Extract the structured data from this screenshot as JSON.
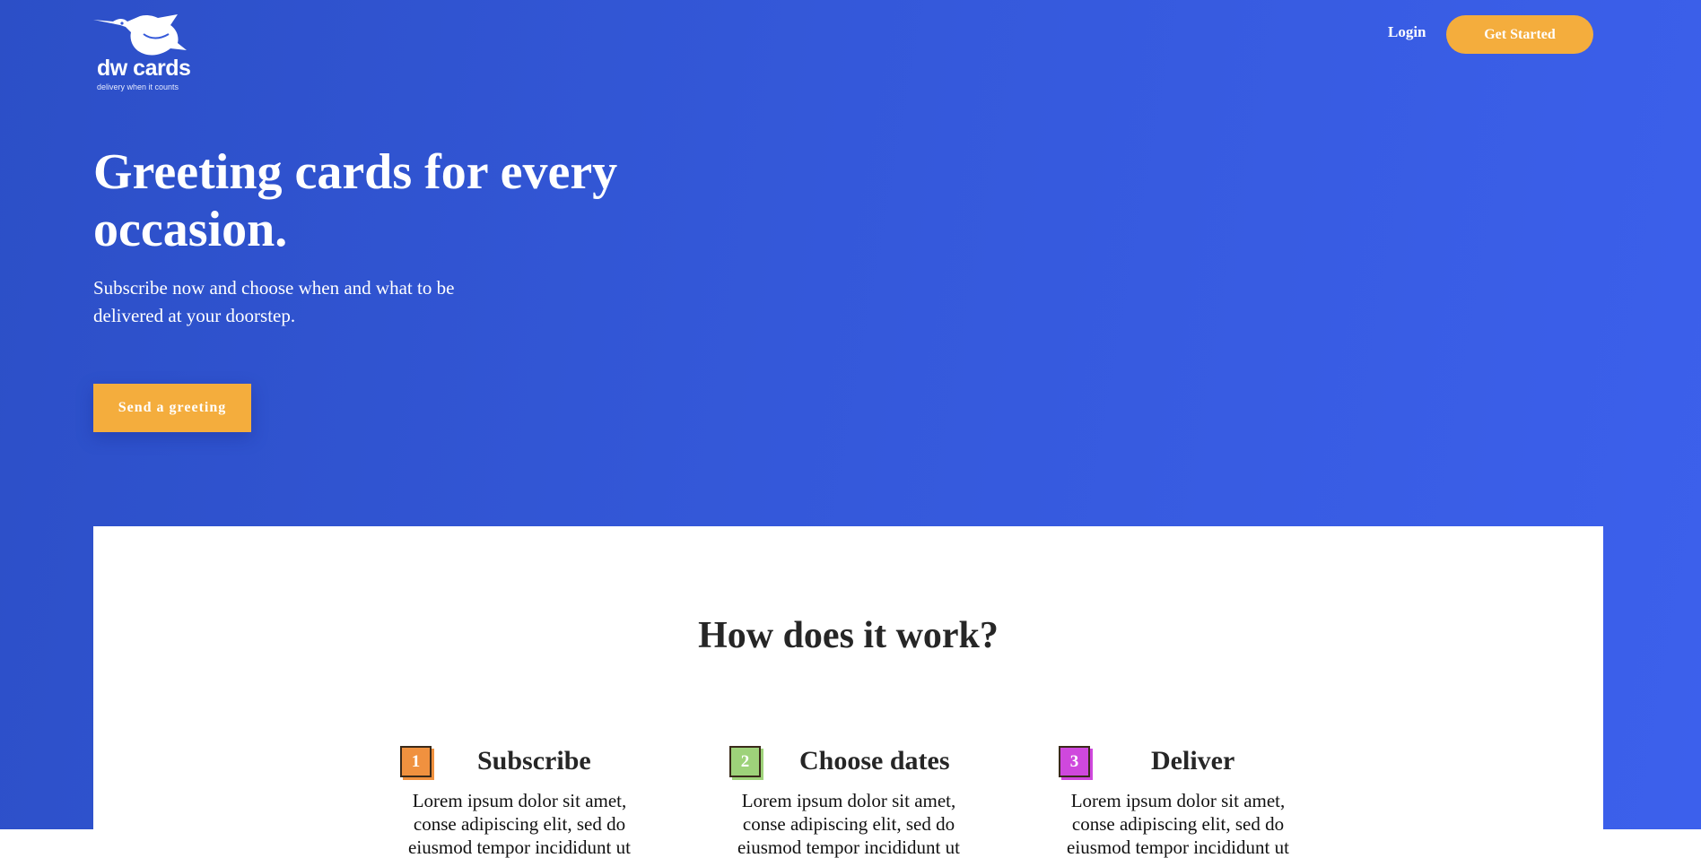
{
  "header": {
    "logo_name": "dw cards",
    "logo_tagline": "delivery when it counts",
    "logo_icon": "hummingbird-icon",
    "login_label": "Login",
    "get_started_label": "Get Started"
  },
  "hero": {
    "title": "Greeting cards for every occasion.",
    "subtitle": "Subscribe now and choose when and what to be delivered at your doorstep.",
    "cta_label": "Send a greeting"
  },
  "how": {
    "title": "How does it work?",
    "steps": [
      {
        "number": "1",
        "title": "Subscribe",
        "text": "Lorem ipsum dolor sit amet, conse adipiscing elit, sed do eiusmod tempor incididunt ut",
        "color": "#f0913f"
      },
      {
        "number": "2",
        "title": "Choose dates",
        "text": "Lorem ipsum dolor sit amet, conse adipiscing elit, sed do eiusmod tempor incididunt ut",
        "color": "#9ed27a"
      },
      {
        "number": "3",
        "title": "Deliver",
        "text": "Lorem ipsum dolor sit amet, conse adipiscing elit, sed do eiusmod tempor incididunt ut",
        "color": "#cf48dd"
      }
    ]
  },
  "colors": {
    "hero_start": "#2c4fc7",
    "hero_end": "#3c60ec",
    "accent": "#f4ad3d"
  }
}
